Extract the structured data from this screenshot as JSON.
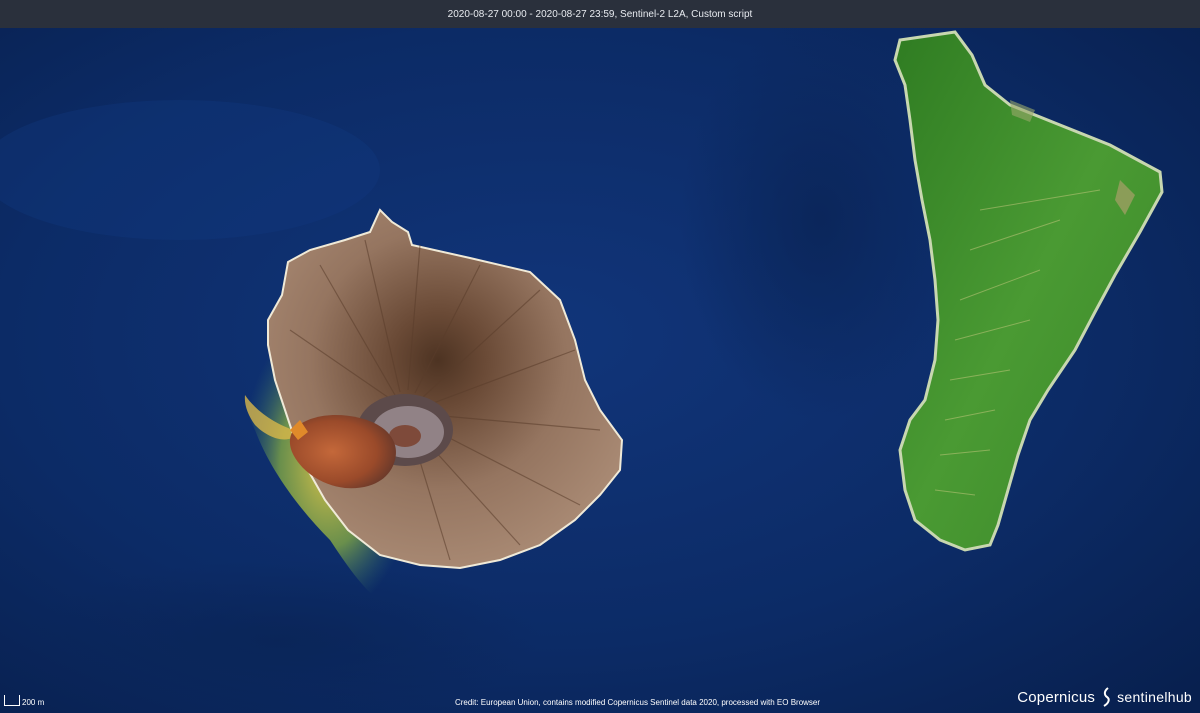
{
  "header": {
    "caption": "2020-08-27 00:00 - 2020-08-27 23:59, Sentinel-2 L2A, Custom script"
  },
  "scale": {
    "label": "200 m"
  },
  "footer": {
    "credit": "Credit: European Union, contains modified Copernicus Sentinel data 2020, processed with EO Browser"
  },
  "logos": {
    "copernicus": "Copernicus",
    "sentinelhub": "sentinelhub"
  },
  "colors": {
    "ocean": "#0b2a64",
    "volcano_ash": "#8a6a52",
    "lava_flow": "#a5502c",
    "vegetation": "#3f8f2a",
    "discolored_water": "#b8b13a"
  },
  "icons": [
    "scale-bar-icon",
    "copernicus-logo",
    "sentinelhub-logo"
  ]
}
